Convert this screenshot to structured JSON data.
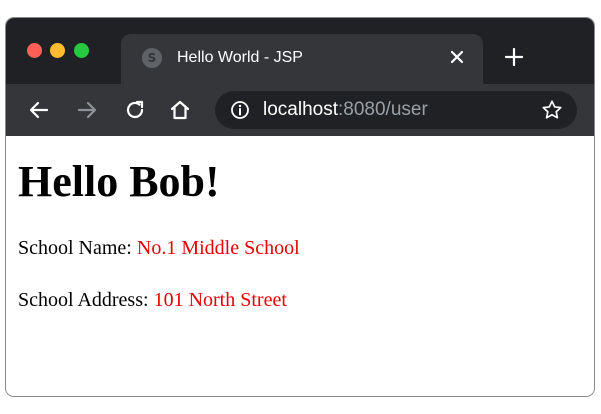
{
  "window": {
    "traffic_lights": [
      "close",
      "minimize",
      "zoom"
    ],
    "colors": {
      "red": "#ff5f57",
      "yellow": "#febc2e",
      "green": "#28c840"
    }
  },
  "tab": {
    "title": "Hello World - JSP",
    "favicon": "globe-icon",
    "close_icon": "close-icon"
  },
  "new_tab_icon": "plus-icon",
  "toolbar": {
    "back_icon": "back-arrow-icon",
    "forward_icon": "forward-arrow-icon",
    "reload_icon": "reload-icon",
    "home_icon": "home-icon",
    "info_icon": "info-icon",
    "bookmark_icon": "star-icon",
    "url_host": "localhost",
    "url_rest": ":8080/user"
  },
  "page": {
    "heading": "Hello Bob!",
    "school_name_label": "School Name: ",
    "school_name_value": "No.1 Middle School",
    "school_address_label": "School Address: ",
    "school_address_value": "101 North Street",
    "value_color": "#e60000"
  }
}
